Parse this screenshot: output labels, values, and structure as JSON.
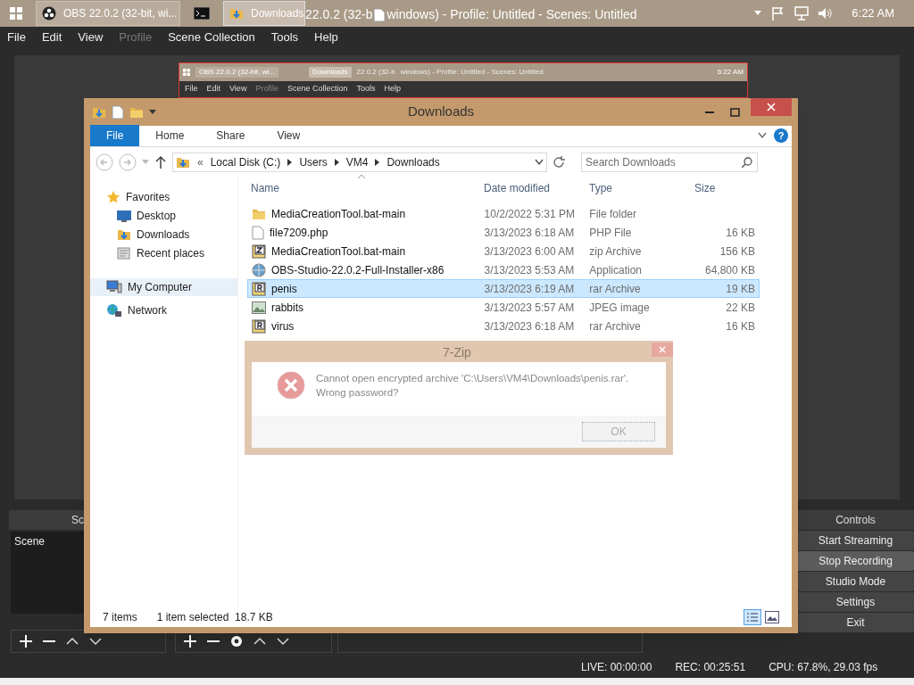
{
  "taskbar": {
    "tasks": [
      {
        "kind": "obs",
        "label": "OBS 22.0.2 (32-bit, wi...",
        "selected": false
      },
      {
        "kind": "cmd",
        "selected": false
      },
      {
        "kind": "folder",
        "label": "Downloads",
        "selected": true
      }
    ],
    "obs_title_parts": [
      "22.0.2 (32-b",
      "windows) - Profile: Untitled - Scenes: Untitled"
    ],
    "clock": "6:22 AM"
  },
  "menu": [
    {
      "label": "File",
      "disabled": false
    },
    {
      "label": "Edit",
      "disabled": false
    },
    {
      "label": "View",
      "disabled": false
    },
    {
      "label": "Profile",
      "disabled": true
    },
    {
      "label": "Scene Collection",
      "disabled": false
    },
    {
      "label": "Tools",
      "disabled": false
    },
    {
      "label": "Help",
      "disabled": false
    }
  ],
  "preview": {
    "tasks": [
      "OBS 22.0.2 (32-bit, wi...",
      "Downloads"
    ],
    "title_parts": [
      "22.0.2 (32-b",
      "windows) - Profile: Untitled - Scenes: Untitled"
    ],
    "clock": "6:22 AM",
    "menu": [
      "File",
      "Edit",
      "View",
      "Profile",
      "Scene Collection",
      "Tools",
      "Help"
    ]
  },
  "scenes_dock": {
    "title": "Sc",
    "items": [
      {
        "label": "Scene",
        "selected": false
      }
    ]
  },
  "controls": {
    "title": "Controls",
    "buttons": [
      {
        "label": "Start Streaming",
        "active": false
      },
      {
        "label": "Stop Recording",
        "active": true
      },
      {
        "label": "Studio Mode",
        "active": false
      },
      {
        "label": "Settings",
        "active": false
      },
      {
        "label": "Exit",
        "active": false
      }
    ]
  },
  "status_bar": {
    "live": "LIVE: 00:00:00",
    "rec": "REC: 00:25:51",
    "cpu": "CPU: 67.8%, 29.03 fps"
  },
  "explorer": {
    "title": "Downloads",
    "ribbon_tabs": [
      {
        "label": "File",
        "selected": true
      },
      {
        "label": "Home",
        "selected": false
      },
      {
        "label": "Share",
        "selected": false
      },
      {
        "label": "View",
        "selected": false
      }
    ],
    "help_glyph": "?",
    "address_overflow": "«",
    "breadcrumbs": [
      "Local Disk (C:)",
      "Users",
      "VM4",
      "Downloads"
    ],
    "search": {
      "placeholder": "Search Downloads"
    },
    "nav": [
      {
        "label": "Favorites",
        "selected": false,
        "children": [
          {
            "label": "Desktop",
            "selected": false
          },
          {
            "label": "Downloads",
            "selected": false
          },
          {
            "label": "Recent places",
            "selected": false
          }
        ]
      },
      {
        "label": "My Computer",
        "selected": true
      },
      {
        "label": "Network",
        "selected": false
      }
    ],
    "columns": [
      "Name",
      "Date modified",
      "Type",
      "Size"
    ],
    "rows": [
      {
        "kind": "folder",
        "name": "MediaCreationTool.bat-main",
        "date": "10/2/2022 5:31 PM",
        "type": "File folder",
        "selected": false
      },
      {
        "kind": "file",
        "name": "file7209.php",
        "date": "3/13/2023 6:18 AM",
        "type": "PHP File",
        "size": "16 KB",
        "selected": false
      },
      {
        "kind": "zip",
        "name": "MediaCreationTool.bat-main",
        "date": "3/13/2023 6:00 AM",
        "type": "zip Archive",
        "size": "156 KB",
        "selected": false
      },
      {
        "kind": "app",
        "name": "OBS-Studio-22.0.2-Full-Installer-x86",
        "date": "3/13/2023 5:53 AM",
        "type": "Application",
        "size": "64,800 KB",
        "selected": false
      },
      {
        "kind": "rar",
        "name": "penis",
        "date": "3/13/2023 6:19 AM",
        "type": "rar Archive",
        "size": "19 KB",
        "selected": true
      },
      {
        "kind": "image",
        "name": "rabbits",
        "date": "3/13/2023 5:57 AM",
        "type": "JPEG image",
        "size": "22 KB",
        "selected": false
      },
      {
        "kind": "rar",
        "name": "virus",
        "date": "3/13/2023 6:18 AM",
        "type": "rar Archive",
        "size": "16 KB",
        "selected": false
      }
    ],
    "status": {
      "count": "7 items",
      "selection": "1 item selected  18.7 KB"
    }
  },
  "dialog": {
    "title": "7-Zip",
    "message": "Cannot open encrypted archive 'C:\\Users\\VM4\\Downloads\\penis.rar'.",
    "message2": "Wrong password?",
    "button": "OK"
  }
}
